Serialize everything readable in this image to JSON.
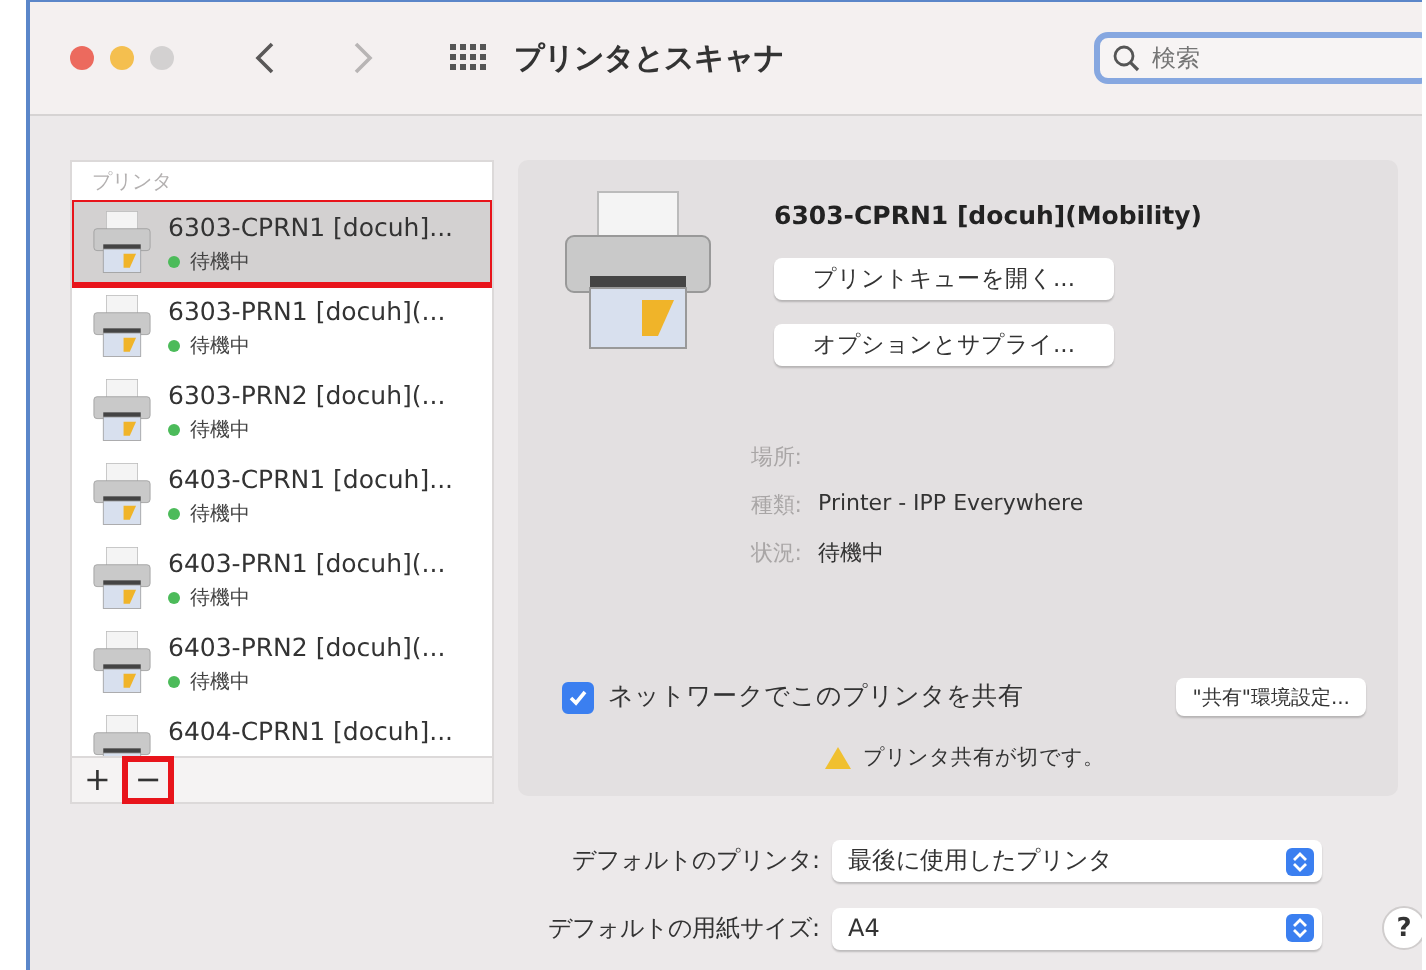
{
  "window": {
    "title": "プリンタとスキャナ"
  },
  "navigation": {
    "back_disabled": false,
    "forward_disabled": true
  },
  "search": {
    "placeholder": "検索",
    "focused": true
  },
  "sidebar": {
    "heading": "プリンタ",
    "items": [
      {
        "name": "6303-CPRN1 [docuh]...",
        "status": "待機中",
        "selected": true,
        "highlighted": true
      },
      {
        "name": "6303-PRN1 [docuh](...",
        "status": "待機中",
        "selected": false,
        "highlighted": false
      },
      {
        "name": "6303-PRN2 [docuh](...",
        "status": "待機中",
        "selected": false,
        "highlighted": false
      },
      {
        "name": "6403-CPRN1 [docuh]...",
        "status": "待機中",
        "selected": false,
        "highlighted": false
      },
      {
        "name": "6403-PRN1 [docuh](...",
        "status": "待機中",
        "selected": false,
        "highlighted": false
      },
      {
        "name": "6403-PRN2 [docuh](...",
        "status": "待機中",
        "selected": false,
        "highlighted": false
      },
      {
        "name": "6404-CPRN1 [docuh]...",
        "selected": false,
        "highlighted": false
      }
    ],
    "add_button": {
      "label": "+",
      "highlighted": false
    },
    "remove_button": {
      "label": "−",
      "highlighted": true
    }
  },
  "detail": {
    "name": "6303-CPRN1 [docuh](Mobility)",
    "buttons": [
      "プリントキューを開く...",
      "オプションとサプライ..."
    ],
    "info": [
      {
        "label": "場所:"
      },
      {
        "label": "種類:",
        "value": "Printer - IPP Everywhere"
      },
      {
        "label": "状況:",
        "value": "待機中"
      }
    ],
    "share": {
      "label": "ネットワークでこのプリンタを共有",
      "checked": true
    },
    "share_prefs_button": "\"共有\"環境設定...",
    "warning": "プリンタ共有が切です。"
  },
  "defaults": [
    {
      "label": "デフォルトのプリンタ:",
      "value": "最後に使用したプリンタ"
    },
    {
      "label": "デフォルトの用紙サイズ:",
      "value": "A4"
    }
  ],
  "help_button": "?"
}
